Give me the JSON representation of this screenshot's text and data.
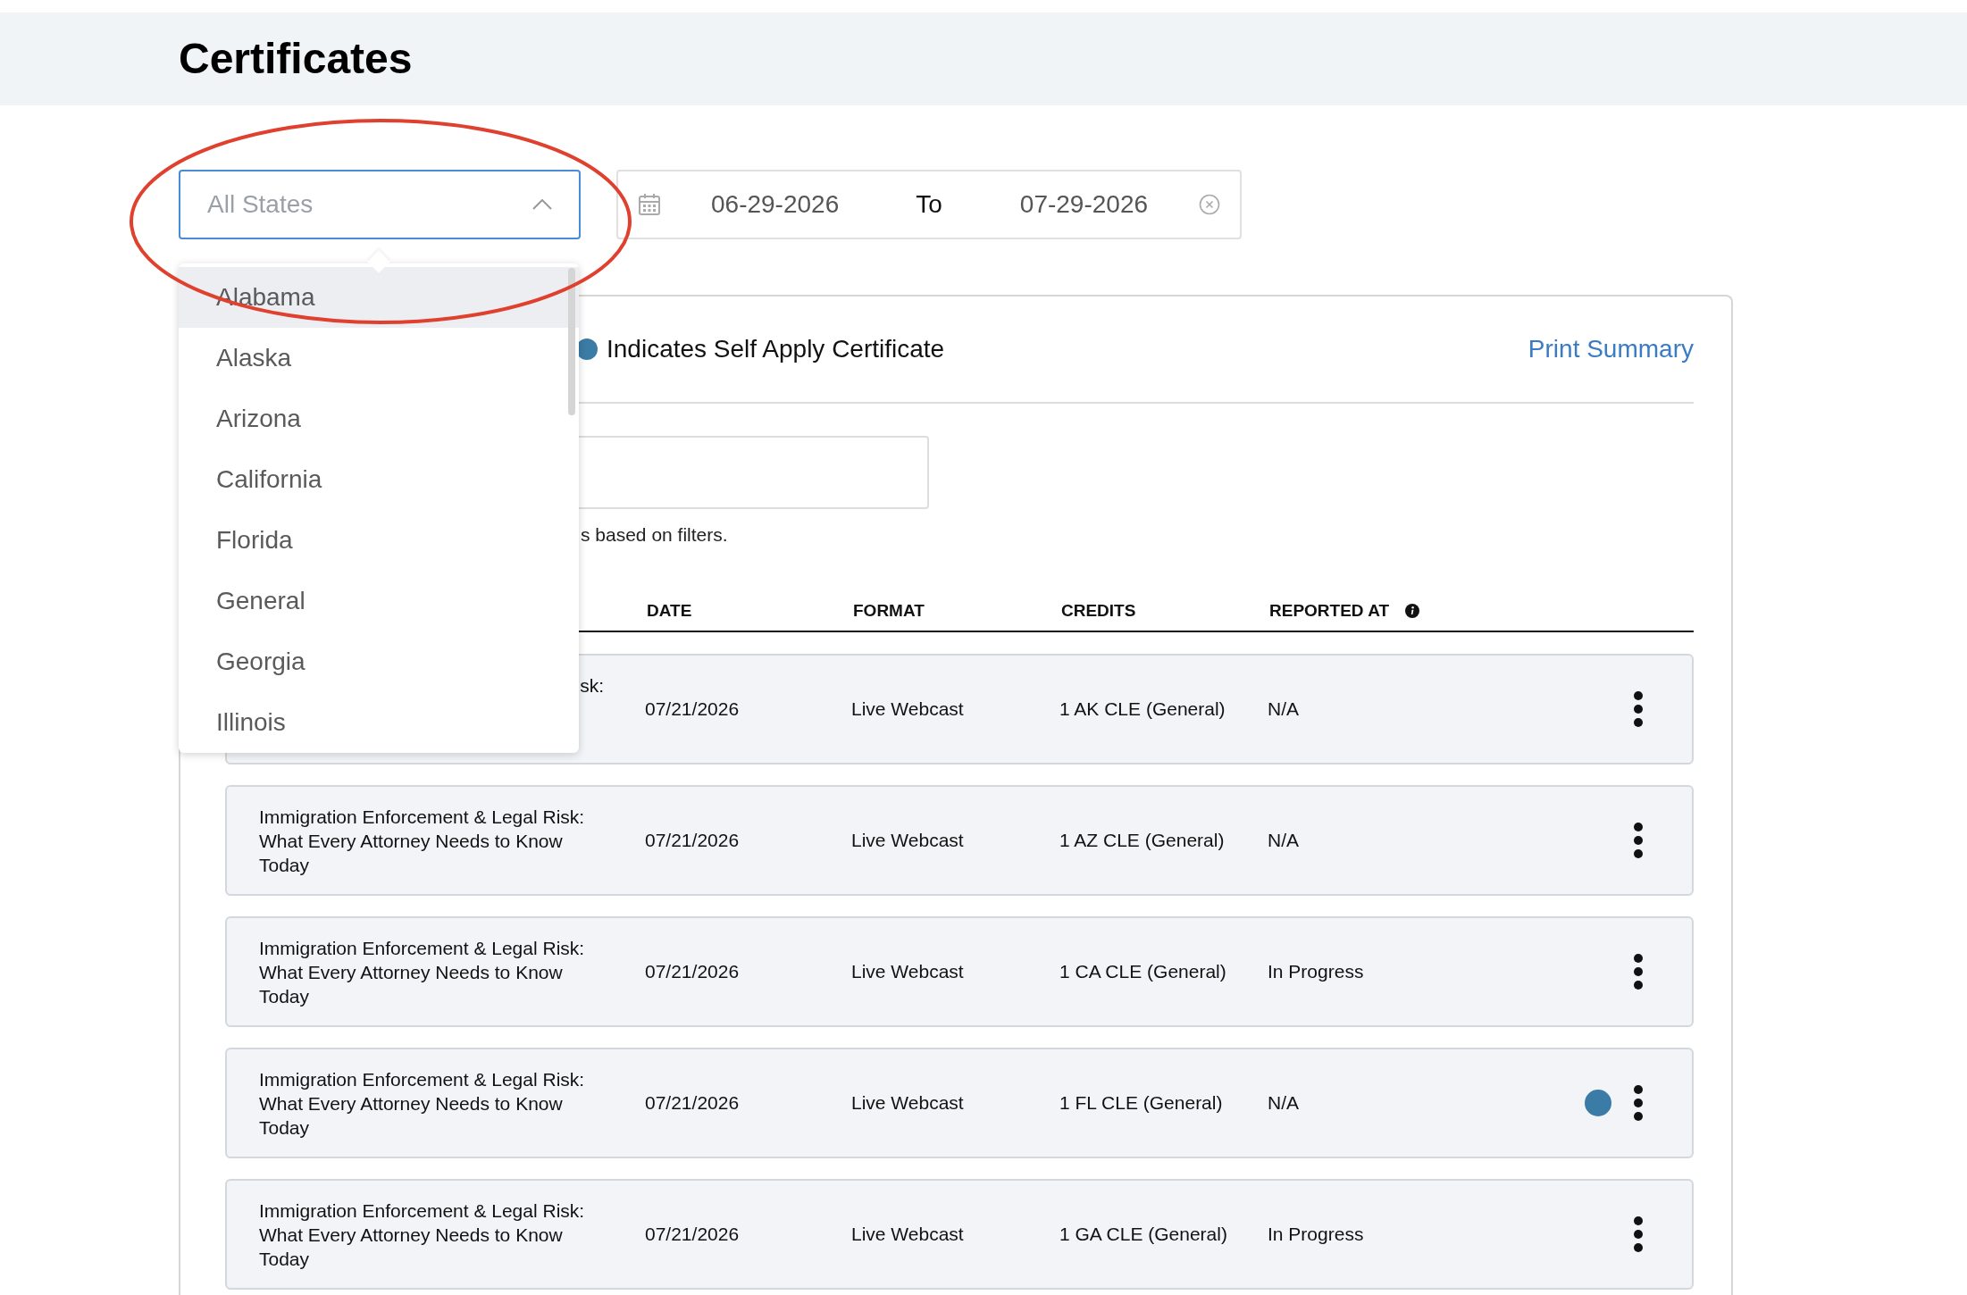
{
  "header": {
    "title": "Certificates"
  },
  "filters": {
    "state_select": {
      "placeholder": "All States",
      "expanded": true
    },
    "date_range": {
      "start": "06-29-2026",
      "separator": "To",
      "end": "07-29-2026"
    }
  },
  "state_menu": {
    "items": [
      {
        "label": "Alabama",
        "selected": true
      },
      {
        "label": "Alaska",
        "selected": false
      },
      {
        "label": "Arizona",
        "selected": false
      },
      {
        "label": "California",
        "selected": false
      },
      {
        "label": "Florida",
        "selected": false
      },
      {
        "label": "General",
        "selected": false
      },
      {
        "label": "Georgia",
        "selected": false
      },
      {
        "label": "Illinois",
        "selected": false
      }
    ]
  },
  "legend": {
    "text": "Indicates Self Apply Certificate"
  },
  "print_link": "Print Summary",
  "results_note": "s based on filters.",
  "table": {
    "columns": [
      {
        "label": "DATE",
        "info": false
      },
      {
        "label": "FORMAT",
        "info": false
      },
      {
        "label": "CREDITS",
        "info": false
      },
      {
        "label": "REPORTED AT",
        "info": true
      }
    ],
    "rows": [
      {
        "kind": "covered",
        "title": "sk:",
        "date": "07/21/2026",
        "format": "Live Webcast",
        "credits": "1 AK CLE (General)",
        "reported_at": "N/A",
        "self_apply": false
      },
      {
        "kind": "full",
        "title": "Immigration Enforcement & Legal Risk: What Every Attorney Needs to Know Today",
        "date": "07/21/2026",
        "format": "Live Webcast",
        "credits": "1 AZ CLE (General)",
        "reported_at": "N/A",
        "self_apply": false
      },
      {
        "kind": "full",
        "title": "Immigration Enforcement & Legal Risk: What Every Attorney Needs to Know Today",
        "date": "07/21/2026",
        "format": "Live Webcast",
        "credits": "1 CA CLE (General)",
        "reported_at": "In Progress",
        "self_apply": false
      },
      {
        "kind": "full",
        "title": "Immigration Enforcement & Legal Risk: What Every Attorney Needs to Know Today",
        "date": "07/21/2026",
        "format": "Live Webcast",
        "credits": "1 FL CLE (General)",
        "reported_at": "N/A",
        "self_apply": true
      },
      {
        "kind": "full",
        "title": "Immigration Enforcement & Legal Risk: What Every Attorney Needs to Know Today",
        "date": "07/21/2026",
        "format": "Live Webcast",
        "credits": "1 GA CLE (General)",
        "reported_at": "In Progress",
        "self_apply": false
      }
    ]
  },
  "annotations": [
    {
      "kind": "ellipse"
    }
  ]
}
